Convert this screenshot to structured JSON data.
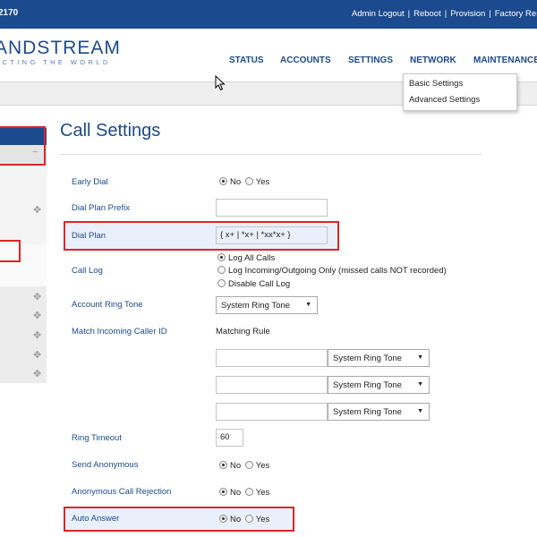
{
  "header": {
    "model": "2170",
    "links": [
      "Admin Logout",
      "Reboot",
      "Provision",
      "Factory Rese"
    ],
    "separator": "|"
  },
  "logo": {
    "brand": "ANDSTREAM",
    "tagline": "ECTING THE WORLD"
  },
  "nav": {
    "status": "STATUS",
    "accounts": "ACCOUNTS",
    "settings": "SETTINGS",
    "network": "NETWORK",
    "maintenance": "MAINTENANCE"
  },
  "dropdown": {
    "items": [
      "Basic Settings",
      "Advanced Settings"
    ]
  },
  "page": {
    "title": "Call Settings"
  },
  "form": {
    "early_dial": {
      "label": "Early Dial",
      "options": [
        "No",
        "Yes"
      ],
      "selected": "No"
    },
    "dial_plan_prefix": {
      "label": "Dial Plan Prefix",
      "value": ""
    },
    "dial_plan": {
      "label": "Dial Plan",
      "value": "{ x+ | *x+ | *xx*x+ }"
    },
    "call_log": {
      "label": "Call Log",
      "options": [
        "Log All Calls",
        "Log Incoming/Outgoing Only (missed calls NOT recorded)",
        "Disable Call Log"
      ],
      "selected": "Log All Calls"
    },
    "account_ring_tone": {
      "label": "Account Ring Tone",
      "value": "System Ring Tone"
    },
    "match_incoming": {
      "label": "Match Incoming Caller ID",
      "column_header": "Matching Rule",
      "rows": [
        {
          "rule": "",
          "tone": "System Ring Tone"
        },
        {
          "rule": "",
          "tone": "System Ring Tone"
        },
        {
          "rule": "",
          "tone": "System Ring Tone"
        }
      ]
    },
    "ring_timeout": {
      "label": "Ring Timeout",
      "value": "60"
    },
    "send_anonymous": {
      "label": "Send Anonymous",
      "options": [
        "No",
        "Yes"
      ],
      "selected": "No"
    },
    "anonymous_call_rejection": {
      "label": "Anonymous Call Rejection",
      "options": [
        "No",
        "Yes"
      ],
      "selected": "No"
    },
    "auto_answer": {
      "label": "Auto Answer",
      "options": [
        "No",
        "Yes"
      ],
      "selected": "No"
    }
  },
  "sidebar": {
    "icons": [
      "minus-icon",
      "plus-icon",
      "plus-icon",
      "plus-icon",
      "plus-icon",
      "plus-icon",
      "plus-icon"
    ]
  },
  "colors": {
    "brand_blue": "#1c4a8e",
    "highlight_red": "#e02424",
    "highlight_row": "#eaf0fb"
  }
}
